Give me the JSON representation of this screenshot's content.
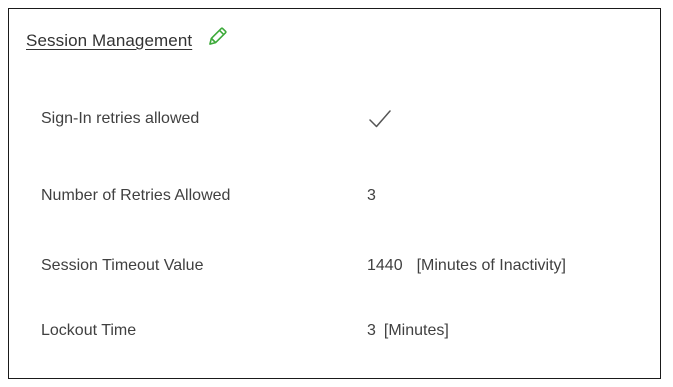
{
  "section": {
    "title": "Session Management",
    "edit_icon": "pencil-icon",
    "edit_icon_color": "#3daa3a"
  },
  "fields": {
    "signin_retries": {
      "label": "Sign-In retries allowed",
      "value_icon": "checkmark-icon",
      "checked": true
    },
    "retries_allowed": {
      "label": "Number of Retries Allowed",
      "value": "3"
    },
    "session_timeout": {
      "label": "Session Timeout Value",
      "value": "1440",
      "unit": "[Minutes of Inactivity]"
    },
    "lockout_time": {
      "label": "Lockout Time",
      "value": "3",
      "unit": "[Minutes]"
    }
  }
}
